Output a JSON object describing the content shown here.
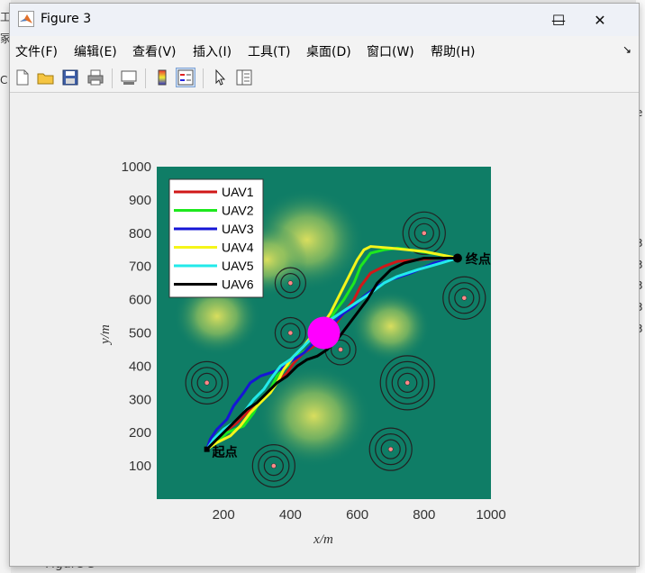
{
  "window": {
    "title": "Figure 3"
  },
  "window_controls": {
    "minimize": "—",
    "maximize": "☐",
    "close": "✕"
  },
  "menu": {
    "items": [
      "文件(F)",
      "编辑(E)",
      "查看(V)",
      "插入(I)",
      "工具(T)",
      "桌面(D)",
      "窗口(W)",
      "帮助(H)"
    ],
    "overflow": "↘"
  },
  "toolbar": {
    "icons": [
      "new-figure-icon",
      "open-file-icon",
      "save-icon",
      "print-icon",
      "link-plot-icon",
      "colorbar-icon",
      "legend-icon",
      "pointer-icon",
      "property-inspector-icon"
    ]
  },
  "background": {
    "left_chars": [
      "工",
      "冢",
      "C"
    ],
    "right_chars": [
      "e",
      "3",
      "3",
      "3",
      "3",
      "3",
      ")",
      ")"
    ],
    "bottom_text": "Figure 3"
  },
  "colors": {
    "field_low": "#0f7d66",
    "field_high": "#e4e35e",
    "start_goal_marker": "#000000",
    "center_marker": "#ff00ff",
    "threat_ring": "#222222",
    "threat_center": "#ff8a8a"
  },
  "chart_data": {
    "type": "line",
    "xlabel": "x/m",
    "ylabel": "y/m",
    "xlim": [
      0,
      1000
    ],
    "ylim": [
      0,
      1000
    ],
    "xticks": [
      200,
      400,
      600,
      800,
      1000
    ],
    "yticks": [
      100,
      200,
      300,
      400,
      500,
      600,
      700,
      800,
      900,
      1000
    ],
    "legend_position": "top-left",
    "start": {
      "x": 150,
      "y": 150,
      "label": "起点"
    },
    "goal": {
      "x": 900,
      "y": 725,
      "label": "终点"
    },
    "center_marker": {
      "x": 500,
      "y": 500
    },
    "threats": [
      {
        "x": 800,
        "y": 800,
        "rings": 3
      },
      {
        "x": 920,
        "y": 605,
        "rings": 3
      },
      {
        "x": 400,
        "y": 650,
        "rings": 2
      },
      {
        "x": 400,
        "y": 500,
        "rings": 2
      },
      {
        "x": 550,
        "y": 450,
        "rings": 2
      },
      {
        "x": 150,
        "y": 350,
        "rings": 3
      },
      {
        "x": 750,
        "y": 350,
        "rings": 4
      },
      {
        "x": 700,
        "y": 150,
        "rings": 3
      },
      {
        "x": 350,
        "y": 100,
        "rings": 3
      }
    ],
    "series": [
      {
        "name": "UAV1",
        "color": "#d01818",
        "x": [
          150,
          170,
          200,
          240,
          270,
          300,
          330,
          360,
          390,
          410,
          440,
          470,
          500,
          530,
          560,
          590,
          610,
          640,
          680,
          720,
          780,
          840,
          900
        ],
        "y": [
          150,
          170,
          200,
          230,
          260,
          280,
          320,
          350,
          380,
          410,
          440,
          460,
          500,
          520,
          560,
          600,
          640,
          680,
          700,
          715,
          720,
          725,
          725
        ]
      },
      {
        "name": "UAV2",
        "color": "#1ee81e",
        "x": [
          150,
          180,
          210,
          260,
          290,
          310,
          340,
          360,
          390,
          420,
          450,
          490,
          510,
          530,
          560,
          590,
          610,
          640,
          680,
          720,
          790,
          850,
          900
        ],
        "y": [
          150,
          170,
          200,
          220,
          260,
          300,
          330,
          370,
          400,
          430,
          450,
          490,
          520,
          560,
          600,
          650,
          700,
          740,
          750,
          755,
          745,
          735,
          725
        ]
      },
      {
        "name": "UAV3",
        "color": "#1616d6",
        "x": [
          150,
          160,
          180,
          210,
          230,
          260,
          280,
          310,
          340,
          370,
          410,
          440,
          470,
          500,
          530,
          560,
          590,
          620,
          660,
          700,
          760,
          830,
          900
        ],
        "y": [
          150,
          180,
          210,
          240,
          280,
          320,
          350,
          370,
          380,
          390,
          420,
          440,
          470,
          500,
          530,
          560,
          580,
          610,
          640,
          660,
          680,
          710,
          725
        ]
      },
      {
        "name": "UAV4",
        "color": "#f5f51a",
        "x": [
          150,
          180,
          220,
          250,
          280,
          310,
          340,
          360,
          380,
          410,
          440,
          470,
          500,
          520,
          540,
          560,
          580,
          600,
          620,
          640,
          700,
          800,
          900
        ],
        "y": [
          150,
          170,
          190,
          220,
          260,
          290,
          320,
          350,
          390,
          430,
          460,
          500,
          530,
          560,
          600,
          640,
          680,
          720,
          750,
          760,
          755,
          745,
          725
        ]
      },
      {
        "name": "UAV5",
        "color": "#22eaea",
        "x": [
          150,
          170,
          200,
          230,
          260,
          290,
          320,
          340,
          370,
          400,
          430,
          460,
          490,
          520,
          550,
          580,
          610,
          640,
          680,
          720,
          780,
          850,
          900
        ],
        "y": [
          150,
          180,
          210,
          230,
          260,
          300,
          330,
          360,
          400,
          420,
          450,
          480,
          510,
          540,
          560,
          580,
          600,
          620,
          650,
          670,
          690,
          710,
          725
        ]
      },
      {
        "name": "UAV6",
        "color": "#000000",
        "x": [
          150,
          180,
          210,
          240,
          270,
          300,
          330,
          360,
          390,
          420,
          450,
          480,
          510,
          540,
          570,
          600,
          630,
          660,
          700,
          740,
          800,
          860,
          900
        ],
        "y": [
          150,
          180,
          210,
          240,
          270,
          290,
          320,
          350,
          370,
          400,
          420,
          430,
          450,
          480,
          520,
          560,
          600,
          650,
          690,
          710,
          725,
          725,
          725
        ]
      }
    ]
  }
}
